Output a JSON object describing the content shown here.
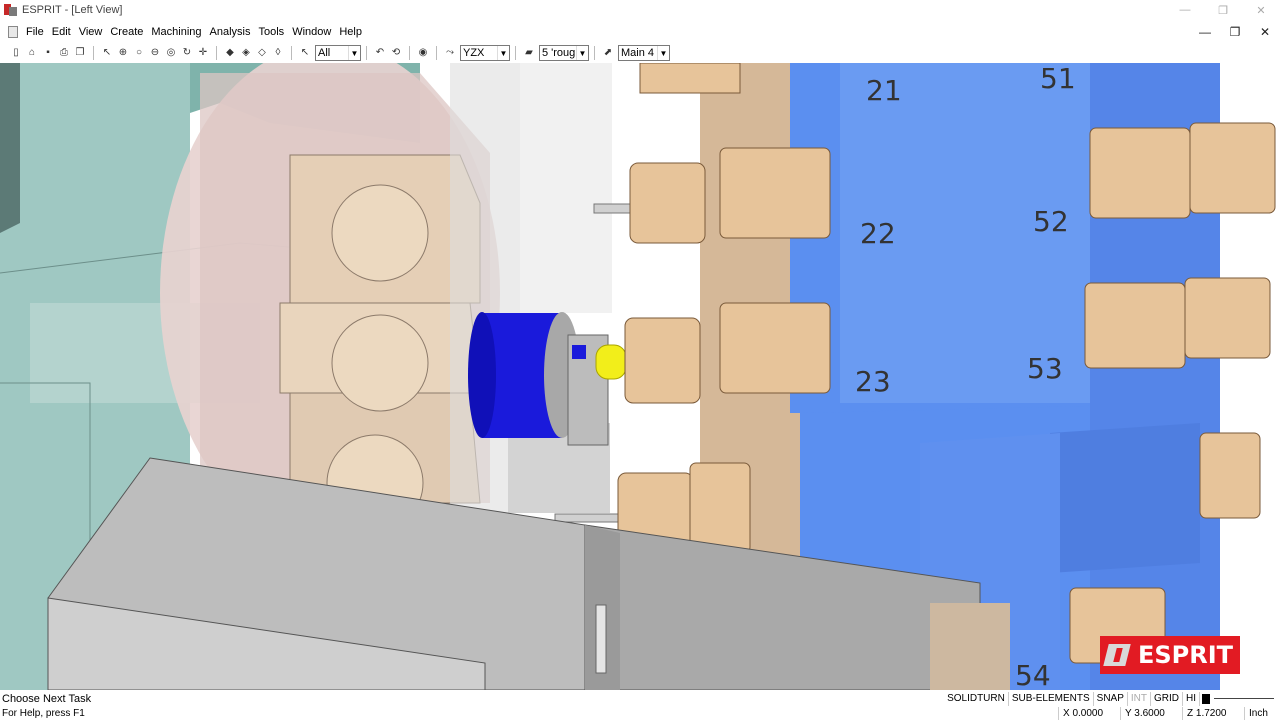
{
  "titlebar": {
    "title": "ESPRIT - [Left View]",
    "minimize": "—",
    "restore": "❐",
    "close": "✕"
  },
  "menubar": {
    "items": [
      "File",
      "Edit",
      "View",
      "Create",
      "Machining",
      "Analysis",
      "Tools",
      "Window",
      "Help"
    ],
    "mdi_minimize": "—",
    "mdi_restore": "❐",
    "mdi_close": "✕"
  },
  "toolbar": {
    "select_filter": "All",
    "plane": "YZX",
    "operation": "5 'rough",
    "work_plane": "Main 4"
  },
  "viewport": {
    "turret_labels": [
      "21",
      "22",
      "23",
      "51",
      "52",
      "53",
      "54"
    ]
  },
  "logo": {
    "text": "ESPRIT"
  },
  "status": {
    "message": "Choose Next Task",
    "help": "For Help, press F1",
    "panels": [
      "SOLIDTURN",
      "SUB-ELEMENTS",
      "SNAP",
      "INT",
      "GRID",
      "HI"
    ],
    "x": "X 0.0000",
    "y": "Y 3.6000",
    "z": "Z 1.7200",
    "unit": "Inch"
  },
  "colors": {
    "turret_blue": "#5b8ff0",
    "tool_tan": "#e7c49a",
    "part_blue": "#1a1adb",
    "insert_yellow": "#f2ee1a",
    "logo_red": "#e21b23"
  }
}
